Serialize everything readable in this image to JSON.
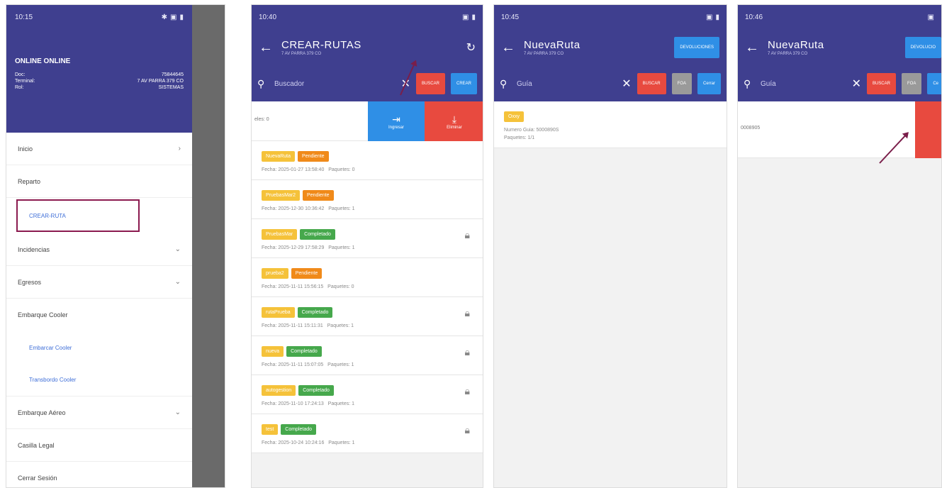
{
  "screen1": {
    "time": "10:15",
    "drawer": {
      "user": "ONLINE ONLINE",
      "fields": [
        {
          "label": "Doc:",
          "value": "75844645"
        },
        {
          "label": "Terminal:",
          "value": "7 AV PARRA 379 CO"
        },
        {
          "label": "Rol:",
          "value": "SISTEMAS"
        }
      ],
      "menu": {
        "inicio": "Inicio",
        "reparto": "Reparto",
        "crear_ruta": "CREAR-RUTA",
        "incidencias": "Incidencias",
        "egresos": "Egresos",
        "embarque_cooler": "Embarque Cooler",
        "embarcar_cooler": "Embarcar Cooler",
        "transbordo_cooler": "Transbordo Cooler",
        "embarque_aereo": "Embarque Aéreo",
        "casilla_legal": "Casilla Legal",
        "cerrar_sesion": "Cerrar Sesión"
      }
    },
    "highlight_color": "#8b1a4f"
  },
  "screen2": {
    "time": "10:40",
    "title": "CREAR-RUTAS",
    "subtitle": "7 AV PARRA 379 CO",
    "search_placeholder": "Buscador",
    "buscar": "BUSCAR",
    "crear": "CREAR",
    "swipe_left_text": "eles: 0",
    "swipe_ingresar": "Ingresar",
    "swipe_eliminar": "Eliminar",
    "routes": [
      {
        "name": "NuevaRuta",
        "status": "Pendiente",
        "status_color": "orange",
        "date": "Fecha: 2025-01-27 13:58:40",
        "packages": "Paquetes: 0",
        "locked": false
      },
      {
        "name": "PruebasMar2",
        "status": "Pendiente",
        "status_color": "orange",
        "date": "Fecha: 2025-12-30 10:36:42",
        "packages": "Paquetes: 1",
        "locked": false
      },
      {
        "name": "PruebasMar",
        "status": "Completado",
        "status_color": "green",
        "date": "Fecha: 2025-12-29 17:58:29",
        "packages": "Paquetes: 1",
        "locked": true
      },
      {
        "name": "prueba2",
        "status": "Pendiente",
        "status_color": "orange",
        "date": "Fecha: 2025-11-11 15:56:15",
        "packages": "Paquetes: 0",
        "locked": false
      },
      {
        "name": "rutaPrueba",
        "status": "Completado",
        "status_color": "green",
        "date": "Fecha: 2025-11-11 15:11:31",
        "packages": "Paquetes: 1",
        "locked": true
      },
      {
        "name": "nueva",
        "status": "Completado",
        "status_color": "green",
        "date": "Fecha: 2025-11-11 15:07:05",
        "packages": "Paquetes: 1",
        "locked": true
      },
      {
        "name": "autogestion",
        "status": "Completado",
        "status_color": "green",
        "date": "Fecha: 2025-11-10 17:24:13",
        "packages": "Paquetes: 1",
        "locked": true
      },
      {
        "name": "test",
        "status": "Completado",
        "status_color": "green",
        "date": "Fecha: 2025-10-24 10:24:16",
        "packages": "Paquetes: 1",
        "locked": true
      }
    ]
  },
  "screen3": {
    "time": "10:45",
    "title": "NuevaRuta",
    "subtitle": "7 AV PARRA 379 CO",
    "devoluciones": "DEVOLUCIONES",
    "search_placeholder": "Guía",
    "buscar": "BUSCAR",
    "foa": "FOA",
    "cerrar": "Cerrar",
    "item": {
      "tag": "Oxxy",
      "guia": "Numero Guia: 5000890S",
      "paquetes": "Paquetes: 1/1"
    }
  },
  "screen4": {
    "time": "10:46",
    "title": "NuevaRuta",
    "subtitle": "7 AV PARRA 379 CO",
    "devoluciones": "DEVOLUCIO",
    "search_placeholder": "Guía",
    "buscar": "BUSCAR",
    "foa": "FOA",
    "cerrar": "Ce",
    "left_text": "0008905"
  }
}
